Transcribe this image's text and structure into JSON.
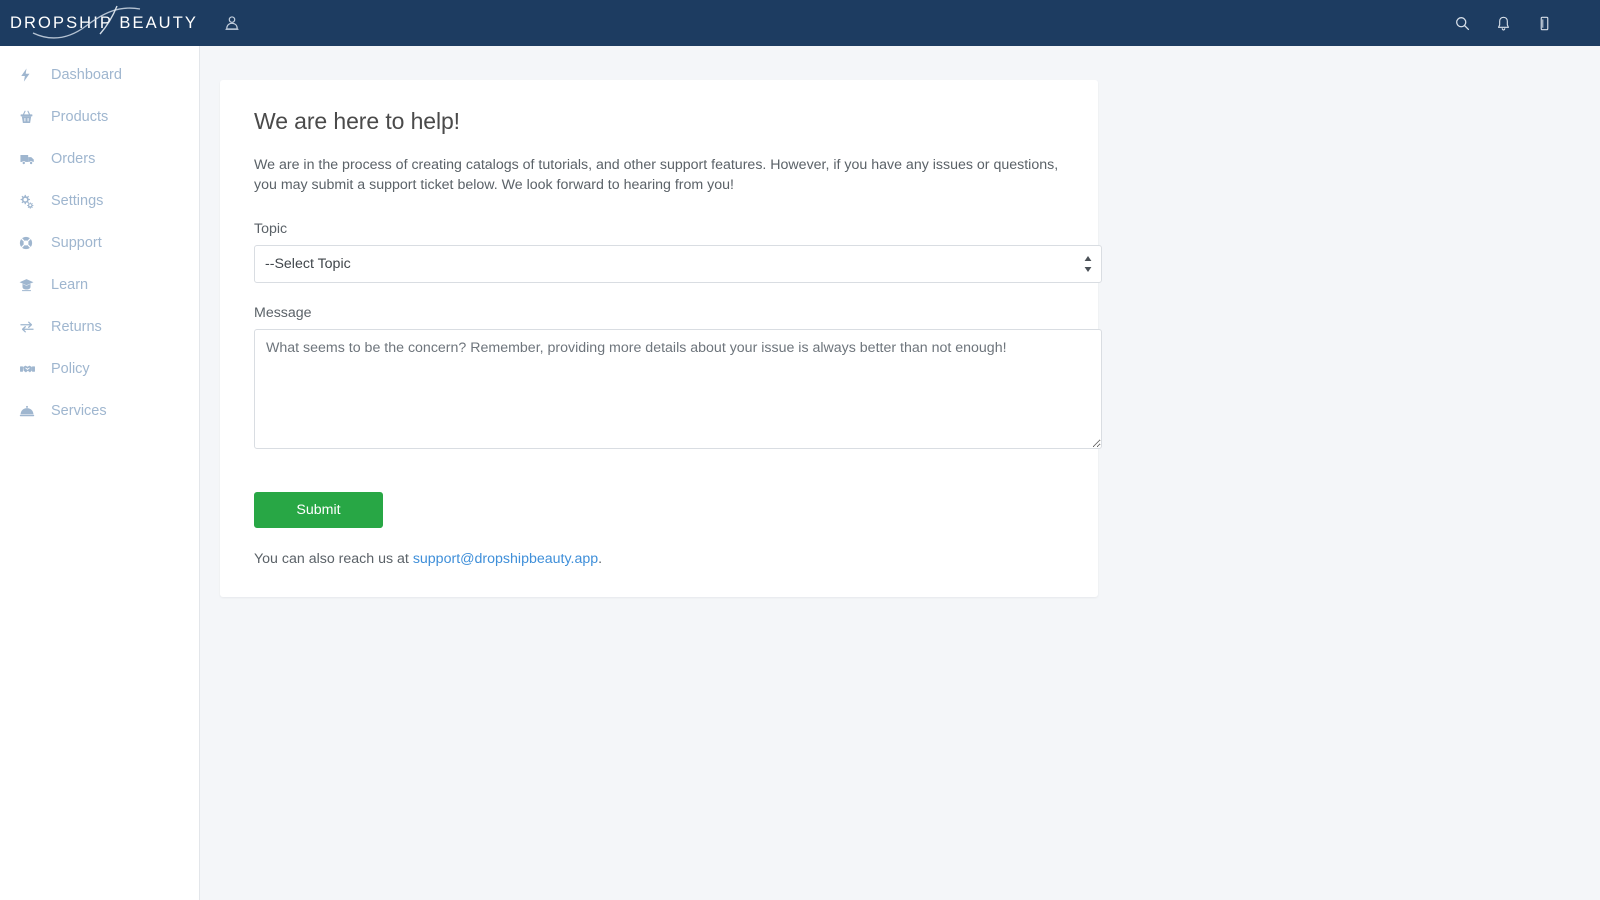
{
  "brand": {
    "name": "DROPSHIP BEAUTY",
    "navbar_color": "#1d3c61"
  },
  "navbar": {
    "user_icon": "user-icon",
    "actions": [
      {
        "icon": "search-icon",
        "label": "Search"
      },
      {
        "icon": "bell-icon",
        "label": "Notifications"
      },
      {
        "icon": "mobile-icon",
        "label": "Mobile app"
      }
    ]
  },
  "sidebar": {
    "items": [
      {
        "label": "Dashboard",
        "icon": "bolt-icon"
      },
      {
        "label": "Products",
        "icon": "basket-icon"
      },
      {
        "label": "Orders",
        "icon": "truck-icon"
      },
      {
        "label": "Settings",
        "icon": "gears-icon"
      },
      {
        "label": "Support",
        "icon": "life-ring-icon"
      },
      {
        "label": "Learn",
        "icon": "graduation-cap-icon"
      },
      {
        "label": "Returns",
        "icon": "exchange-icon"
      },
      {
        "label": "Policy",
        "icon": "handshake-icon"
      },
      {
        "label": "Services",
        "icon": "concierge-bell-icon"
      }
    ],
    "text_color": "#9fb6cf"
  },
  "support_card": {
    "title": "We are here to help!",
    "intro": "We are in the process of creating catalogs of tutorials, and other support features. However, if you have any issues or questions, you may submit a support ticket below. We look forward to hearing from you!",
    "topic": {
      "label": "Topic",
      "selected": "--Select Topic"
    },
    "message": {
      "label": "Message",
      "value": "",
      "placeholder": "What seems to be the concern? Remember, providing more details about your issue is always better than not enough!"
    },
    "submit_label": "Submit",
    "submit_color": "#28a745",
    "footer": {
      "prefix": "You can also reach us at ",
      "email": "support@dropshipbeauty.app",
      "suffix": "."
    }
  }
}
